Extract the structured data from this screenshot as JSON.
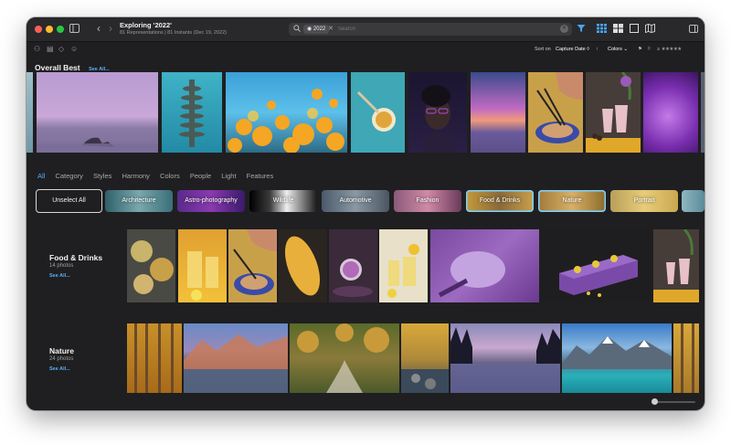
{
  "window": {
    "title": "Exploring '2022'",
    "subtitle": "81 Representations | 81 Instants (Dec 19, 2022)"
  },
  "search": {
    "token": "2022",
    "placeholder": "Search"
  },
  "toolbar": {
    "sort_label": "Sort on",
    "sort_value": "Capture Date ◊",
    "colors_label": "Colors",
    "rating_prefix": "≥",
    "rating_stars": "★★★★★",
    "icons": [
      "filter-icon",
      "grid-view-icon",
      "mosaic-view-icon",
      "single-view-icon",
      "map-view-icon",
      "sidebar-right-icon"
    ]
  },
  "overall_best": {
    "title": "Overall Best",
    "see_all": "See All..."
  },
  "filter_tabs": {
    "active": "All",
    "items": [
      "Category",
      "Styles",
      "Harmony",
      "Colors",
      "People",
      "Light",
      "Features"
    ]
  },
  "chips": {
    "unselect_all": "Unselect All",
    "items": [
      "Architecture",
      "Astro-photography",
      "Wildlife",
      "Automotive",
      "Fashion",
      "Food & Drinks",
      "Nature",
      "Portrait"
    ]
  },
  "sections": [
    {
      "title": "Food & Drinks",
      "count": "14 photos",
      "see_all": "See All..."
    },
    {
      "title": "Nature",
      "count": "24 photos",
      "see_all": "See All..."
    }
  ],
  "colors": {
    "accent": "#5aaef7",
    "window_bg": "#1f1f21",
    "titlebar_bg": "#29292c"
  }
}
